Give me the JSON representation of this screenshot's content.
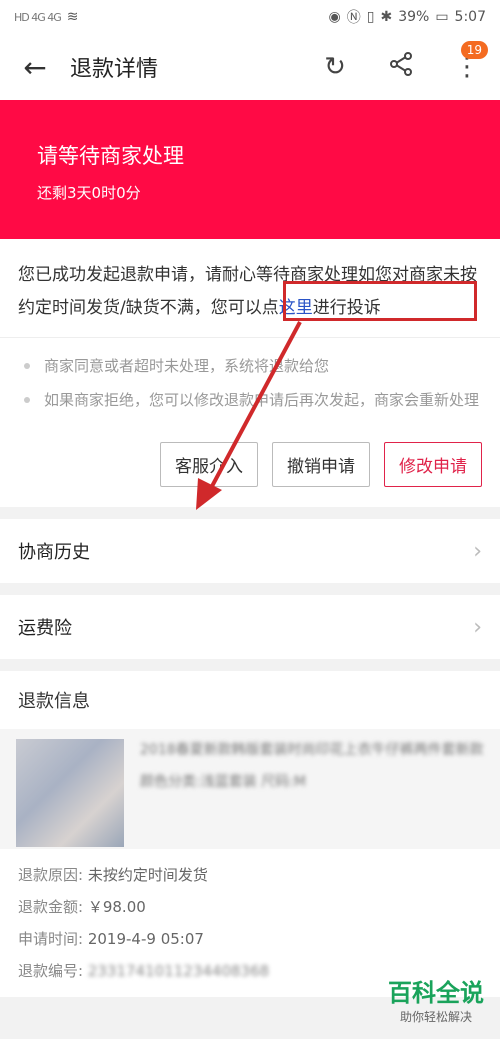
{
  "status": {
    "left_text": "HD 4G 4G",
    "battery": "39%",
    "time": "5:07"
  },
  "nav": {
    "title": "退款详情",
    "badge": "19"
  },
  "banner": {
    "title": "请等待商家处理",
    "subtitle": "还剩3天0时0分"
  },
  "notice": {
    "part1": "您已成功发起退款申请，请耐心等待商家处理如您对商家未按约定时间发货/缺货不满，",
    "part2": "您可以点",
    "link": "这里",
    "part3": "进行投诉"
  },
  "tips": [
    "商家同意或者超时未处理，系统将退款给您",
    "如果商家拒绝，您可以修改退款申请后再次发起，商家会重新处理"
  ],
  "buttons": {
    "service": "客服介入",
    "cancel": "撤销申请",
    "modify": "修改申请"
  },
  "rows": {
    "history": "协商历史",
    "insurance": "运费险"
  },
  "refund": {
    "section_title": "退款信息",
    "product_title": "2018春夏新款韩版套装时尚印花上衣牛仔裤两件套新款",
    "product_spec": "颜色分类:浅蓝套装 尺码:M",
    "reason_label": "退款原因:",
    "reason_value": "未按约定时间发货",
    "amount_label": "退款金额:",
    "amount_value": "￥98.00",
    "time_label": "申请时间:",
    "time_value": "2019-4-9 05:07",
    "number_label": "退款编号:",
    "number_value": "2331741011234408368"
  },
  "watermark": {
    "title": "百科全说",
    "subtitle": "助你轻松解决"
  },
  "colors": {
    "accent_red": "#ff0a45",
    "link_blue": "#2a54c7",
    "annotation_red": "#d0292b"
  }
}
